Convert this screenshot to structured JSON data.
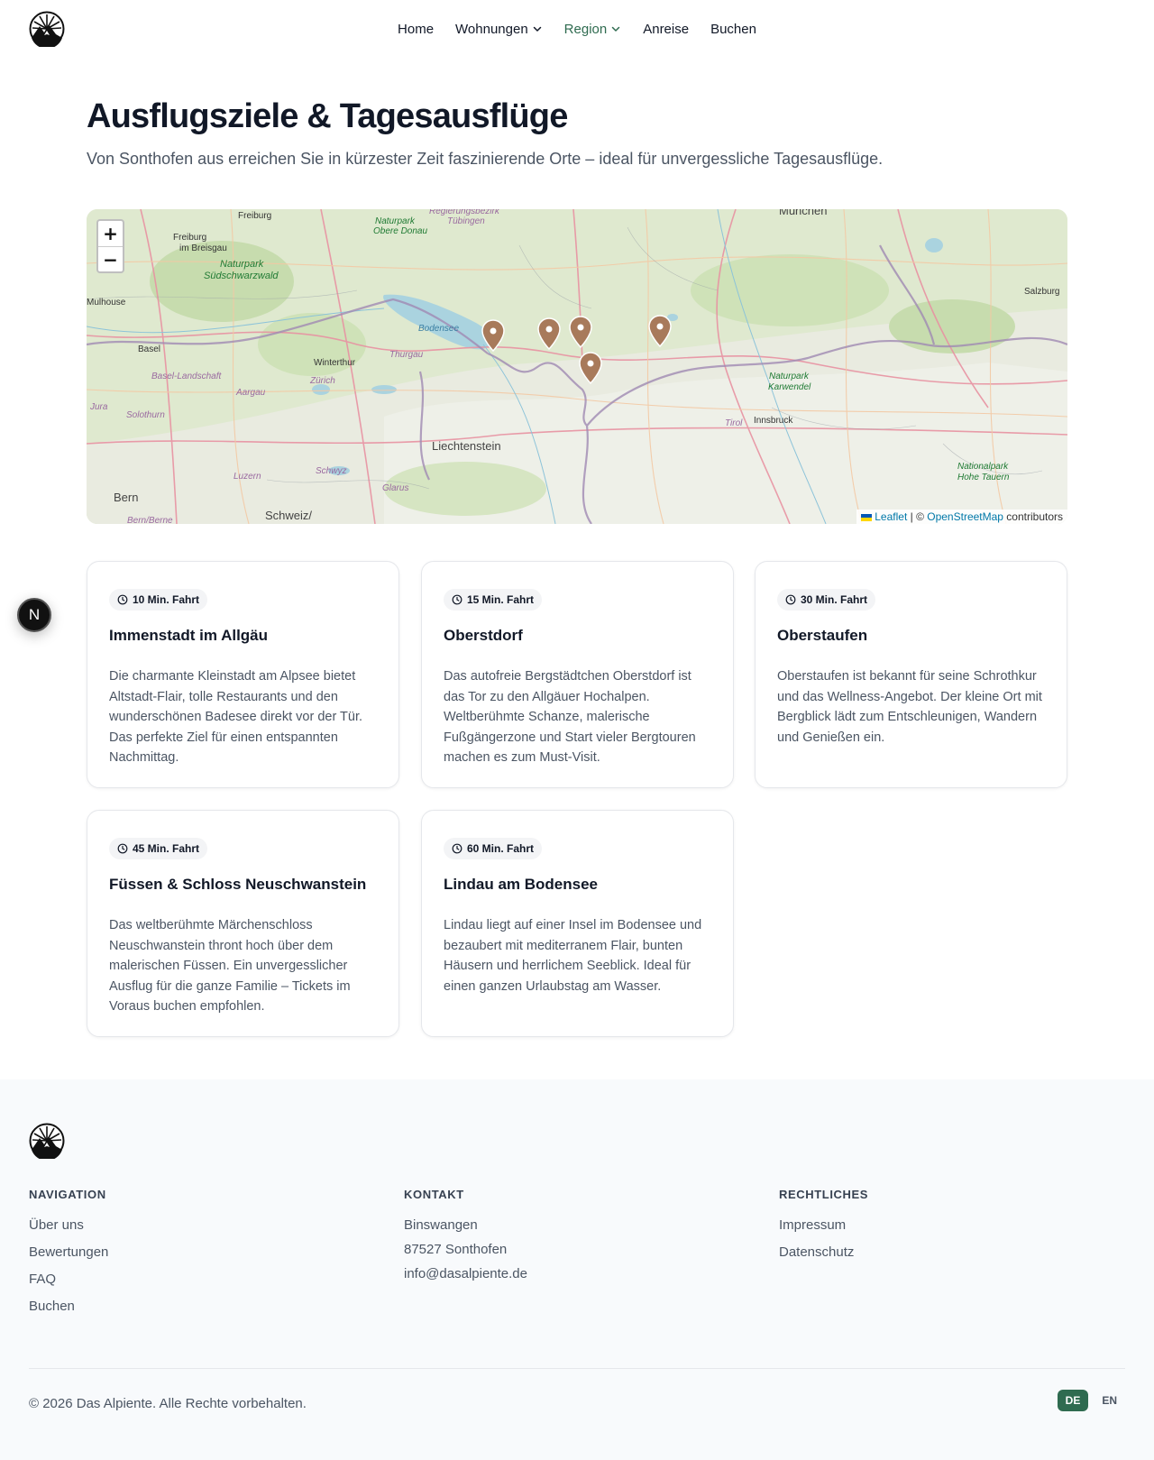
{
  "header": {
    "nav": [
      {
        "label": "Home"
      },
      {
        "label": "Wohnungen"
      },
      {
        "label": "Region"
      },
      {
        "label": "Anreise"
      },
      {
        "label": "Buchen"
      }
    ],
    "active_color": "#2f6b50"
  },
  "hero": {
    "title": "Ausflugsziele & Tagesausflüge",
    "subtitle": "Von Sonthofen aus erreichen Sie in kürzester Zeit faszinierende Orte – ideal für unvergessliche Tagesausflüge."
  },
  "map": {
    "zoom_in": "+",
    "zoom_out": "−",
    "attribution": {
      "leaflet": "Leaflet",
      "separator": " | © ",
      "osm": "OpenStreetMap",
      "suffix": " contributors"
    },
    "labels": {
      "freiburg": "Freiburg",
      "freiburg_breisgau_1": "Freiburg",
      "freiburg_breisgau_2": "im Breisgau",
      "naturpark_sw_1": "Naturpark",
      "naturpark_sw_2": "Südschwarzwald",
      "naturpark_od_1": "Naturpark",
      "naturpark_od_2": "Obere Donau",
      "tuebingen_1": "Regierungsbezirk",
      "tuebingen_2": "Tübingen",
      "muenchen": "München",
      "mulhouse": "Mulhouse",
      "bodensee": "Bodensee",
      "salzburg": "Salzburg",
      "basel": "Basel",
      "winterthur": "Winterthur",
      "thurgau": "Thurgau",
      "basel_landschaft": "Basel-Landschaft",
      "zuerich": "Zürich",
      "aargau": "Aargau",
      "naturpark_kw_1": "Naturpark",
      "naturpark_kw_2": "Karwendel",
      "jura": "Jura",
      "solothurn": "Solothurn",
      "tirol": "Tirol",
      "innsbruck": "Innsbruck",
      "liechtenstein": "Liechtenstein",
      "nationalpark_1": "Nationalpark",
      "nationalpark_2": "Hohe Tauern",
      "luzern": "Luzern",
      "schwyz": "Schwyz",
      "glarus": "Glarus",
      "bern": "Bern",
      "schweiz": "Schweiz/",
      "bern_berne": "Bern/Berne"
    },
    "marker_color": "#a87a5b"
  },
  "destinations": [
    {
      "badge": "10 Min. Fahrt",
      "title": "Immenstadt im Allgäu",
      "text": "Die charmante Kleinstadt am Alpsee bietet Altstadt-Flair, tolle Restaurants und den wunderschönen Badesee direkt vor der Tür. Das perfekte Ziel für einen entspannten Nachmittag."
    },
    {
      "badge": "15 Min. Fahrt",
      "title": "Oberstdorf",
      "text": "Das autofreie Bergstädtchen Oberstdorf ist das Tor zu den Allgäuer Hochalpen. Weltberühmte Schanze, malerische Fußgängerzone und Start vieler Bergtouren machen es zum Must-Visit."
    },
    {
      "badge": "30 Min. Fahrt",
      "title": "Oberstaufen",
      "text": "Oberstaufen ist bekannt für seine Schrothkur und das Wellness-Angebot. Der kleine Ort mit Bergblick lädt zum Entschleunigen, Wandern und Genießen ein."
    },
    {
      "badge": "45 Min. Fahrt",
      "title": "Füssen & Schloss Neuschwanstein",
      "text": "Das weltberühmte Märchenschloss Neuschwanstein thront hoch über dem malerischen Füssen. Ein unvergesslicher Ausflug für die ganze Familie – Tickets im Voraus buchen empfohlen."
    },
    {
      "badge": "60 Min. Fahrt",
      "title": "Lindau am Bodensee",
      "text": "Lindau liegt auf einer Insel im Bodensee und bezaubert mit mediterranem Flair, bunten Häusern und herrlichem Seeblick. Ideal für einen ganzen Urlaubstag am Wasser."
    }
  ],
  "float_button": "N",
  "footer": {
    "navigation": {
      "heading": "NAVIGATION",
      "links": [
        "Über uns",
        "Bewertungen",
        "FAQ",
        "Buchen"
      ]
    },
    "contact": {
      "heading": "KONTAKT",
      "lines": [
        "Binswangen",
        "87527 Sonthofen",
        "info@dasalpiente.de"
      ]
    },
    "legal": {
      "heading": "RECHTLICHES",
      "links": [
        "Impressum",
        "Datenschutz"
      ]
    },
    "copyright": "© 2026 Das Alpiente. Alle Rechte vorbehalten.",
    "languages": [
      {
        "label": "DE"
      },
      {
        "label": "EN"
      }
    ]
  }
}
